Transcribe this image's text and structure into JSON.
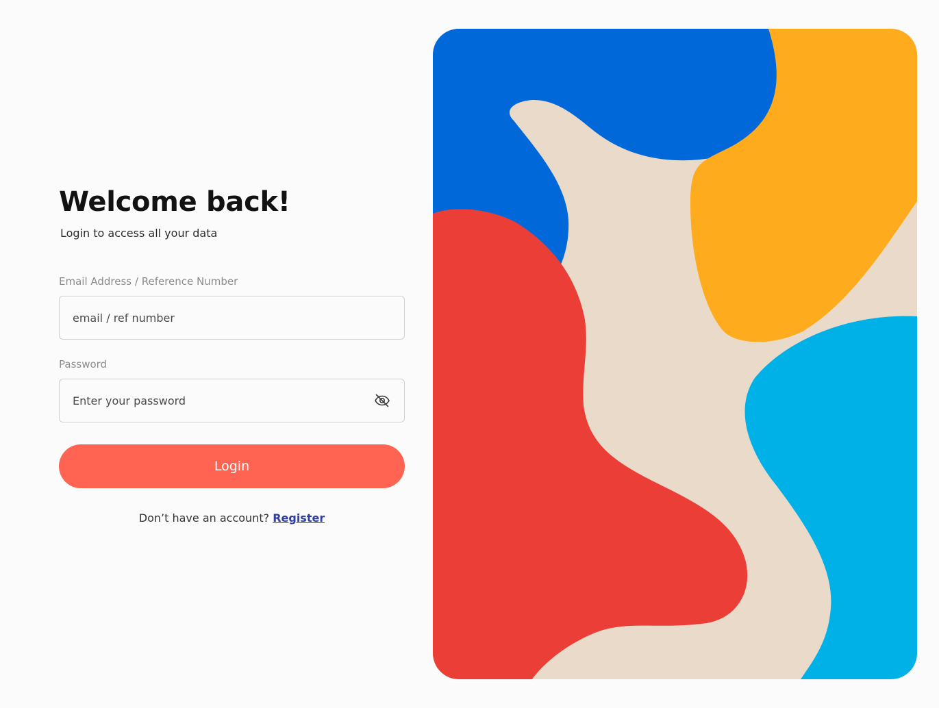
{
  "login": {
    "title": "Welcome back!",
    "subtitle": "Login to access all your data",
    "email_label": "Email Address / Reference Number",
    "email_placeholder": "email / ref number",
    "password_label": "Password",
    "password_placeholder": "Enter your password",
    "login_button": "Login",
    "register_prompt": "Don’t have an account?",
    "register_link": "Register"
  },
  "icons": {
    "password_toggle": "eye-off-icon"
  },
  "colors": {
    "background": "#FBFBFB",
    "accent": "#FF6452",
    "link": "#2E3FA3",
    "art_beige": "#EADACA",
    "art_blue": "#0068D8",
    "art_orange": "#FFAB1E",
    "art_red": "#EB3E37",
    "art_sky": "#00B1E8"
  }
}
